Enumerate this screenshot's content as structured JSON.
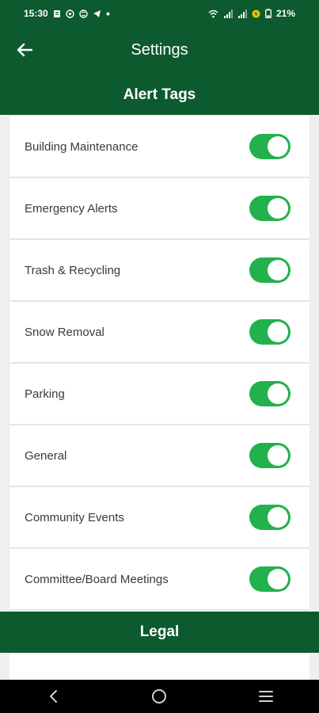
{
  "status_bar": {
    "time": "15:30",
    "battery": "21%",
    "left_icons": [
      "notification-icon",
      "whatsapp-icon",
      "skype-icon",
      "telegram-icon",
      "dot-icon"
    ],
    "right_icons": [
      "wifi-icon",
      "signal-icon",
      "signal-icon",
      "charging-icon",
      "battery-icon"
    ]
  },
  "app_bar": {
    "title": "Settings",
    "back_icon": "arrow-left-icon"
  },
  "section": {
    "title": "Alert Tags"
  },
  "alert_tags": [
    {
      "label": "Building Maintenance",
      "enabled": true
    },
    {
      "label": "Emergency Alerts",
      "enabled": true
    },
    {
      "label": "Trash & Recycling",
      "enabled": true
    },
    {
      "label": "Snow Removal",
      "enabled": true
    },
    {
      "label": "Parking",
      "enabled": true
    },
    {
      "label": "General",
      "enabled": true
    },
    {
      "label": "Community Events",
      "enabled": true
    },
    {
      "label": "Committee/Board Meetings",
      "enabled": true
    }
  ],
  "legal": {
    "title": "Legal"
  },
  "nav_bar": {
    "buttons": [
      "back-nav-icon",
      "home-nav-icon",
      "menu-nav-icon"
    ]
  },
  "colors": {
    "header_green": "#0d5a2e",
    "toggle_green": "#22b14c",
    "list_background": "#eef0ef"
  }
}
